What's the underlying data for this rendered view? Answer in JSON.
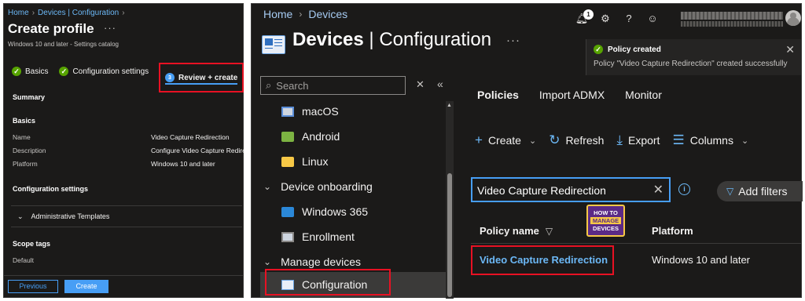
{
  "left_panel": {
    "breadcrumb": [
      "Home",
      "Devices | Configuration"
    ],
    "title": "Create profile",
    "more": "···",
    "subtitle": "Windows 10 and later - Settings catalog",
    "steps": [
      {
        "label": "Basics",
        "state": "complete"
      },
      {
        "label": "Configuration settings",
        "state": "complete"
      },
      {
        "label": "Review + create",
        "state": "active",
        "number": "3"
      }
    ],
    "summary_heading": "Summary",
    "basics_heading": "Basics",
    "basics_rows": [
      {
        "key": "Name",
        "value": "Video Capture Redirection"
      },
      {
        "key": "Description",
        "value": "Configure Video Capture Redirection"
      },
      {
        "key": "Platform",
        "value": "Windows 10 and later"
      }
    ],
    "config_heading": "Configuration settings",
    "expander_label": "Administrative Templates",
    "scope_heading": "Scope tags",
    "scope_value": "Default",
    "previous_label": "Previous",
    "create_label": "Create"
  },
  "right_panel": {
    "breadcrumb": [
      "Home",
      "Devices"
    ],
    "title_bold": "Devices",
    "title_rest": " | Configuration",
    "more": "···",
    "notification_count": "1",
    "toast": {
      "title": "Policy created",
      "message": "Policy \"Video Capture Redirection\" created successfully"
    },
    "search_placeholder": "Search",
    "nav_items": [
      {
        "label": "macOS",
        "type": "child",
        "icon": "macos-icon"
      },
      {
        "label": "Android",
        "type": "child",
        "icon": "android-icon"
      },
      {
        "label": "Linux",
        "type": "child",
        "icon": "linux-icon"
      },
      {
        "label": "Device onboarding",
        "type": "group",
        "icon": "chevron-down-icon"
      },
      {
        "label": "Windows 365",
        "type": "child",
        "icon": "windows365-icon"
      },
      {
        "label": "Enrollment",
        "type": "child",
        "icon": "enrollment-icon"
      },
      {
        "label": "Manage devices",
        "type": "group",
        "icon": "chevron-down-icon"
      },
      {
        "label": "Configuration",
        "type": "child",
        "icon": "configuration-icon",
        "selected": true
      }
    ],
    "tabs": [
      "Policies",
      "Import ADMX",
      "Monitor"
    ],
    "commands": [
      {
        "label": "Create",
        "icon": "plus-icon",
        "chevron": true
      },
      {
        "label": "Refresh",
        "icon": "refresh-icon",
        "chevron": false
      },
      {
        "label": "Export",
        "icon": "download-icon",
        "chevron": false
      },
      {
        "label": "Columns",
        "icon": "columns-icon",
        "chevron": true
      }
    ],
    "filter_value": "Video Capture Redirection",
    "add_filters_label": "Add filters",
    "logo": {
      "line1": "HOW TO",
      "line2": "MANAGE",
      "line3": "DEVICES"
    },
    "table": {
      "headers": [
        "Policy name",
        "Platform"
      ],
      "rows": [
        {
          "policy_name": "Video Capture Redirection",
          "platform": "Windows 10 and later"
        }
      ]
    }
  },
  "colors": {
    "accent": "#479ef5",
    "success": "#57a300",
    "highlight": "#e81123",
    "background": "#1b1a19"
  }
}
